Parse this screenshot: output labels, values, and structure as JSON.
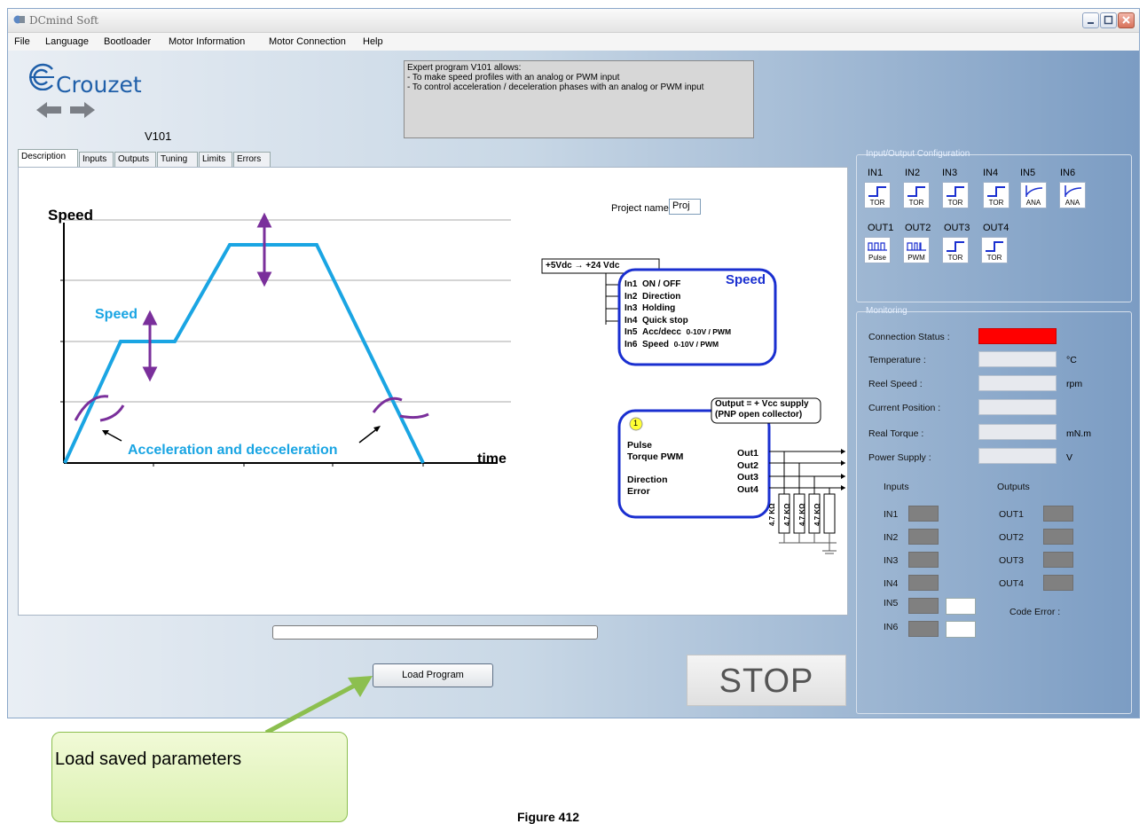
{
  "window": {
    "title": "DCmind Soft"
  },
  "menu": [
    "File",
    "Language",
    "Bootloader",
    "Motor Information",
    "Motor Connection",
    "Help"
  ],
  "logo": {
    "brand": "Crouzet",
    "version": "V101"
  },
  "info_box": {
    "lines": [
      "Expert program V101 allows:",
      "- To make speed profiles with an analog or PWM input",
      "- To control acceleration / deceleration phases with an analog or PWM input"
    ]
  },
  "tabs": [
    "Description",
    "Inputs",
    "Outputs",
    "Tuning",
    "Limits",
    "Errors"
  ],
  "active_tab": "Description",
  "description": {
    "project_label": "Project name:",
    "project_value": "Proj",
    "chart_labels": {
      "y_axis": "Speed",
      "x_axis": "time",
      "speed_curve": "Speed",
      "accel_note": "Acceleration and decceleration"
    },
    "speed_block": {
      "supply": "+5Vdc  →  +24 Vdc",
      "title": "Speed",
      "rows": [
        {
          "pin": "In1",
          "label": "ON / OFF",
          "note": ""
        },
        {
          "pin": "In2",
          "label": "Direction",
          "note": ""
        },
        {
          "pin": "In3",
          "label": "Holding",
          "note": ""
        },
        {
          "pin": "In4",
          "label": "Quick stop",
          "note": ""
        },
        {
          "pin": "In5",
          "label": "Acc/decc",
          "note": "0-10V / PWM"
        },
        {
          "pin": "In6",
          "label": "Speed",
          "note": "0-10V / PWM"
        }
      ]
    },
    "output_block": {
      "header_line1": "Output = + Vcc supply",
      "header_line2": "(PNP open collector)",
      "badge": "1",
      "left": [
        "Pulse",
        "Torque PWM",
        "Direction",
        "Error"
      ],
      "right": [
        "Out1",
        "Out2",
        "Out3",
        "Out4"
      ],
      "resistor": "4.7 KΩ"
    }
  },
  "load_button": "Load Program",
  "stop_button": "STOP",
  "io_config": {
    "title": "Input/Output Configuration",
    "inputs": [
      {
        "name": "IN1",
        "type": "TOR"
      },
      {
        "name": "IN2",
        "type": "TOR"
      },
      {
        "name": "IN3",
        "type": "TOR"
      },
      {
        "name": "IN4",
        "type": "TOR"
      },
      {
        "name": "IN5",
        "type": "ANA"
      },
      {
        "name": "IN6",
        "type": "ANA"
      }
    ],
    "outputs": [
      {
        "name": "OUT1",
        "type": "Pulse"
      },
      {
        "name": "OUT2",
        "type": "PWM"
      },
      {
        "name": "OUT3",
        "type": "TOR"
      },
      {
        "name": "OUT4",
        "type": "TOR"
      }
    ]
  },
  "monitoring": {
    "title": "Monitoring",
    "fields": [
      {
        "label": "Connection Status :",
        "unit": ""
      },
      {
        "label": "Temperature :",
        "unit": "°C"
      },
      {
        "label": "Reel Speed :",
        "unit": "rpm"
      },
      {
        "label": "Current Position :",
        "unit": ""
      },
      {
        "label": "Real Torque :",
        "unit": "mN.m"
      },
      {
        "label": "Power Supply :",
        "unit": "V"
      }
    ],
    "status_color": "#ff0000",
    "inputs_title": "Inputs",
    "outputs_title": "Outputs",
    "inputs": [
      "IN1",
      "IN2",
      "IN3",
      "IN4",
      "IN5",
      "IN6"
    ],
    "outputs": [
      "OUT1",
      "OUT2",
      "OUT3",
      "OUT4"
    ],
    "code_error": "Code Error :"
  },
  "callout": {
    "text": "Load saved parameters"
  },
  "caption": "Figure 412"
}
